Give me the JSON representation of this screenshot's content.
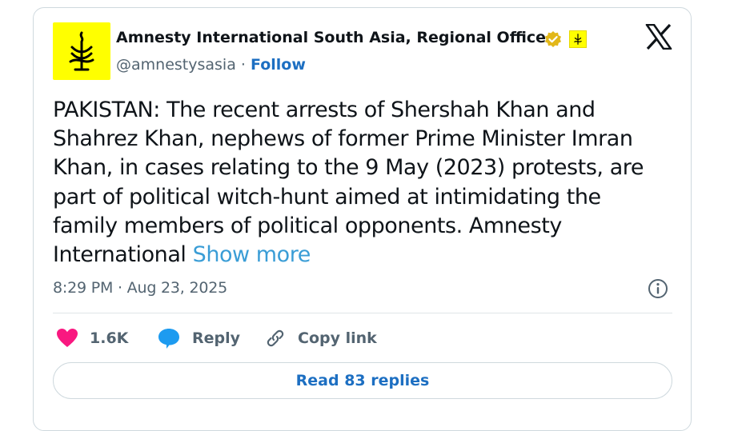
{
  "author": {
    "name": "Amnesty International South Asia, Regional Office",
    "handle": "@amnestysasia",
    "separator": "·",
    "follow_label": "Follow",
    "avatar_color": "#ffff00",
    "verified_badge": "gold-verified-icon",
    "affiliate_badge": "amnesty-candle-icon"
  },
  "tweet": {
    "lines": [
      "PAKISTAN: The recent arrests of Shershah Khan and",
      "Shahrez Khan, nephews of former Prime Minister Imran",
      "Khan, in cases relating to the 9 May (2023) protests, are",
      "part of political witch-hunt aimed at intimidating the",
      "family members of political opponents. Amnesty",
      "International"
    ],
    "show_more_label": "Show more",
    "timestamp": "8:29 PM · Aug 23, 2025"
  },
  "actions": {
    "like_count": "1.6K",
    "reply_label": "Reply",
    "copy_link_label": "Copy link"
  },
  "read_replies_label": "Read 83 replies",
  "colors": {
    "accent": "#1d6fc2",
    "like": "#f91880",
    "reply_icon": "#1d9bf0",
    "secondary_text": "#536471"
  }
}
